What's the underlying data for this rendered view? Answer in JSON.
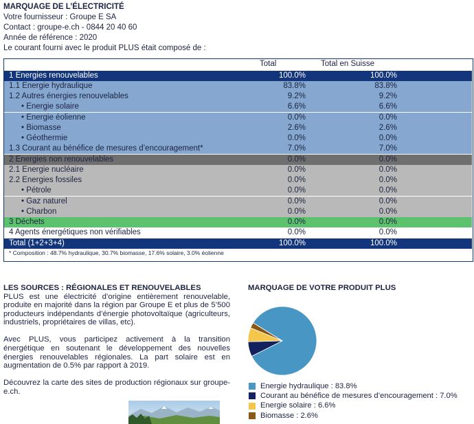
{
  "header": {
    "title": "MARQUAGE DE L’ÉLECTRICITÉ",
    "supplier": "Votre fournisseur : Groupe E SA",
    "contact": "Contact : groupe-e.ch - 0844 20 40 60",
    "year": "Année de référence : 2020",
    "intro": "Le courant fourni avec le produit PLUS était composé de :"
  },
  "table": {
    "col_total": "Total",
    "col_swiss": "Total en Suisse",
    "rows": [
      {
        "label": "1   Energies renouvelables",
        "total": "100.0%",
        "swiss": "100.0%"
      },
      {
        "label": "1.1 Energie hydraulique",
        "total": "83.8%",
        "swiss": "83.8%"
      },
      {
        "label": "1.2 Autres énergies renouvelables",
        "total": "9.2%",
        "swiss": "9.2%"
      },
      {
        "label": "• Energie solaire",
        "total": "6.6%",
        "swiss": "6.6%"
      },
      {
        "label": "• Energie éolienne",
        "total": "0.0%",
        "swiss": "0.0%"
      },
      {
        "label": "• Biomasse",
        "total": "2.6%",
        "swiss": "2.6%"
      },
      {
        "label": "• Géothermie",
        "total": "0.0%",
        "swiss": "0.0%"
      },
      {
        "label": "1.3 Courant au bénéfice de mesures d’encouragement*",
        "total": "7.0%",
        "swiss": "7.0%"
      },
      {
        "label": "2   Energies non renouvelables",
        "total": "0.0%",
        "swiss": "0.0%"
      },
      {
        "label": "2.1 Energie nucléaire",
        "total": "0.0%",
        "swiss": "0.0%"
      },
      {
        "label": "2.2 Energies fossiles",
        "total": "0.0%",
        "swiss": "0.0%"
      },
      {
        "label": "• Pétrole",
        "total": "0.0%",
        "swiss": "0.0%"
      },
      {
        "label": "• Gaz naturel",
        "total": "0.0%",
        "swiss": "0.0%"
      },
      {
        "label": "• Charbon",
        "total": "0.0%",
        "swiss": "0.0%"
      },
      {
        "label": "3   Déchets",
        "total": "0.0%",
        "swiss": "0.0%"
      },
      {
        "label": "4   Agents énergétiques non vérifiables",
        "total": "0.0%",
        "swiss": "0.0%"
      },
      {
        "label": "Total (1+2+3+4)",
        "total": "100.0%",
        "swiss": "100.0%"
      }
    ],
    "footnote": "* Composition : 48.7% hydraulique, 30.7% biomasse, 17.6% solaire, 3.0% éolienne"
  },
  "sources": {
    "title": "LES SOURCES : RÉGIONALES ET RENOUVELABLES",
    "p1": "PLUS est une électricité d’origine entièrement renouvelable, produite en majorité dans la région par Groupe E et plus de 5’500 producteurs indépendants d’énergie photovoltaïque (agriculteurs, industriels, propriétaires de villas, etc).",
    "p2": "Avec PLUS, vous participez activement à la transition énergétique en soutenant le développement des nouvelles énergies renouvelables régionales. La part solaire est en augmentation de 0.5% par rapport à 2019.",
    "p3": "Découvrez la carte des sites de production régionaux sur groupe-e.ch."
  },
  "chart_data": {
    "type": "pie",
    "title": "MARQUAGE DE VOTRE PRODUIT PLUS",
    "slices": [
      {
        "name": "Energie hydraulique",
        "value": 83.8,
        "label": "Energie hydraulique : 83.8%",
        "color": "#4896c3"
      },
      {
        "name": "Courant au bénéfice de mesures d’encouragement",
        "value": 7.0,
        "label": "Courant au bénéfice de mesures d’encouragement : 7.0%",
        "color": "#13215e"
      },
      {
        "name": "Energie solaire",
        "value": 6.6,
        "label": "Energie solaire : 6.6%",
        "color": "#f5c64c"
      },
      {
        "name": "Biomasse",
        "value": 2.6,
        "label": "Biomasse : 2.6%",
        "color": "#8b5616"
      }
    ]
  },
  "colors": {
    "navy": "#13357c",
    "renewable_blue": "#86a7cf",
    "nonrenew_dark": "#6f6f6f",
    "nonrenew_gray": "#b9b9b9",
    "waste_green": "#5dc26e"
  }
}
